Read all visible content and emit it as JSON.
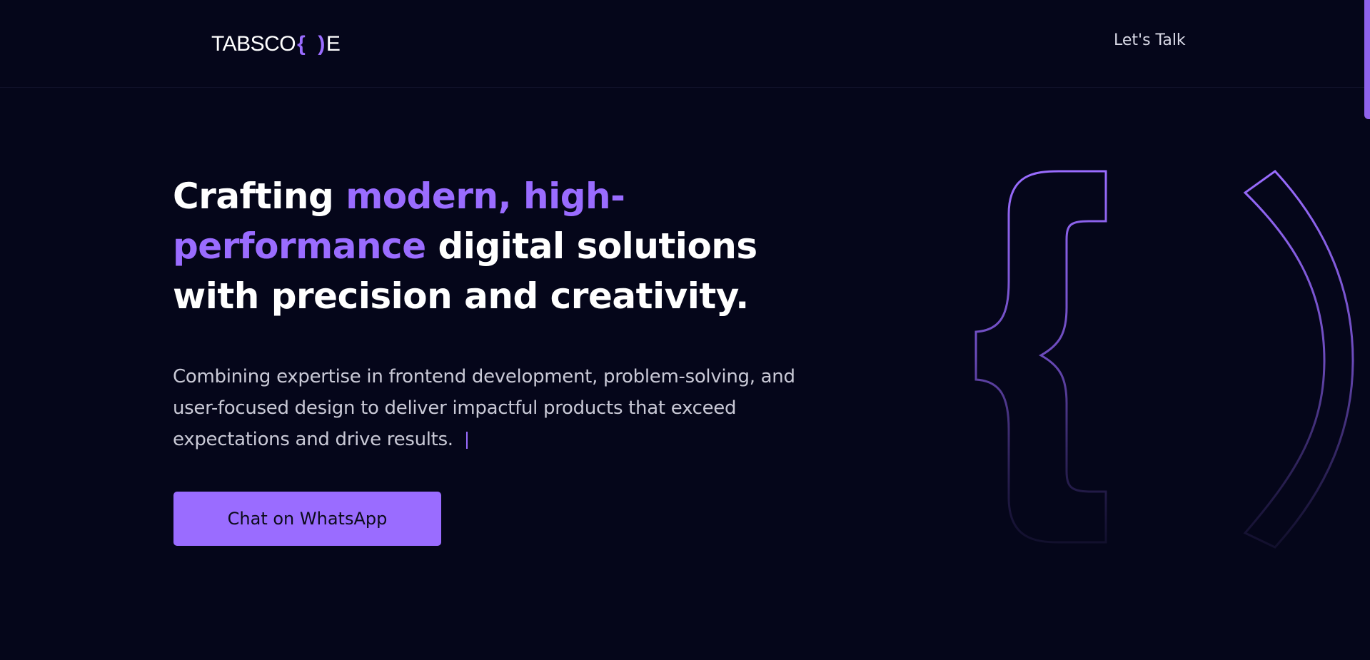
{
  "header": {
    "logo": {
      "part1": "TABSCO",
      "brace_open": "{",
      "brace_close": ")",
      "part2": "E"
    },
    "cta_label": "Let's Talk"
  },
  "hero": {
    "title_part1": "Crafting ",
    "title_highlight": "modern, high-performance",
    "title_part2": " digital solutions with precision and creativity.",
    "description": "Combining expertise in frontend development, problem-solving, and user-focused design to deliver impactful products that exceed expectations and drive results.",
    "button_label": "Chat on WhatsApp"
  },
  "colors": {
    "background": "#05061a",
    "accent": "#9a6cff",
    "text": "#ffffff",
    "muted_text": "#c9c9d6"
  },
  "icons": {
    "decor_brace": "curly-brace-outline",
    "decor_paren": "paren-outline"
  }
}
